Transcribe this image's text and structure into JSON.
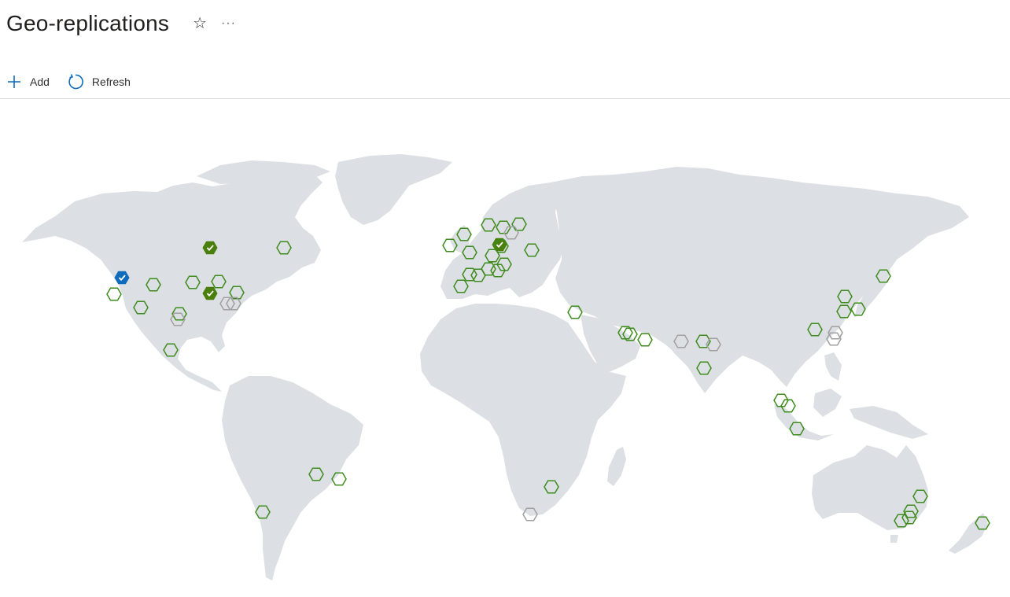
{
  "page": {
    "title": "Geo-replications"
  },
  "toolbar": {
    "add_label": "Add",
    "refresh_label": "Refresh"
  },
  "colors": {
    "land": "#dcdfe3",
    "available": "#3f8c1e",
    "replicated": "#4a7f0b",
    "home": "#0f6cbd",
    "unavailable": "#a0a0a0"
  },
  "legend_states": [
    "home",
    "replicated",
    "available",
    "unavailable"
  ]
}
